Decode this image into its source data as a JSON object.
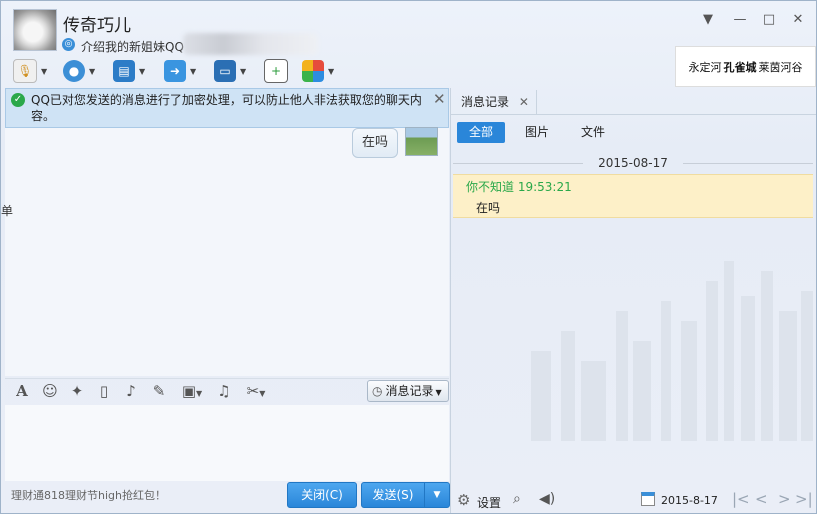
{
  "window": {
    "contact_name": "传奇巧儿",
    "signature": "介绍我的新姐妹QQ",
    "controls": {
      "menu": "▼",
      "minimize": "—",
      "maximize": "□",
      "close": "✕"
    }
  },
  "toolbar": {
    "icons": [
      "microphone-icon",
      "video-camera-icon",
      "screen-share-icon",
      "file-transfer-icon",
      "remote-desktop-icon",
      "add-chat-icon",
      "apps-icon"
    ]
  },
  "ad": {
    "part1": "永定河",
    "part2": "孔雀城",
    "part3": "莱茵河谷"
  },
  "notice": {
    "text": "QQ已对您发送的消息进行了加密处理，可以防止他人非法获取您的聊天内容。",
    "close": "✕"
  },
  "chat": {
    "messages": [
      {
        "text": "在吗"
      }
    ],
    "edge_fragment": "单"
  },
  "format_bar": {
    "history_button": "消息记录"
  },
  "input": {
    "promo_text": "理财通818理财节high抢红包！",
    "close_button": "关闭(C)",
    "send_button": "发送(S)"
  },
  "history": {
    "tab_label": "消息记录",
    "filters": [
      "全部",
      "图片",
      "文件"
    ],
    "date": "2015-08-17",
    "entries": [
      {
        "sender": "你不知道",
        "time": "19:53:21",
        "text": "在吗"
      }
    ],
    "footer": {
      "settings": "设置",
      "date": "2015-8-17"
    }
  },
  "colors": {
    "accent": "#2a86d9",
    "highlight": "#fdf0c8",
    "sender_green": "#2aa84a"
  }
}
